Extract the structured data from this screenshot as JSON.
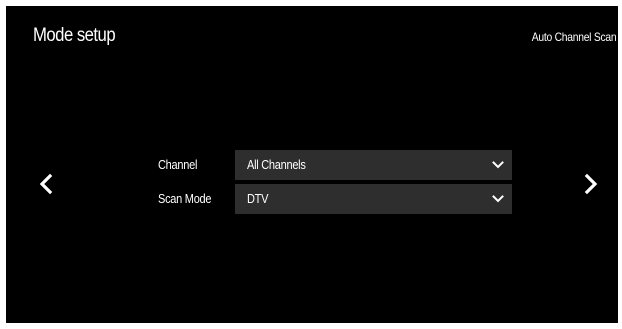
{
  "header": {
    "title": "Mode setup",
    "subtitle": "Auto Channel Scan"
  },
  "navigation": {
    "prev_icon": "chevron-left-icon",
    "next_icon": "chevron-right-icon"
  },
  "form": {
    "rows": [
      {
        "label": "Channel",
        "value": "All Channels",
        "icon": "chevron-down-icon"
      },
      {
        "label": "Scan Mode",
        "value": "DTV",
        "icon": "chevron-down-icon"
      }
    ]
  },
  "colors": {
    "background": "#000000",
    "text": "#ffffff",
    "select_background": "#2e2e2e"
  }
}
